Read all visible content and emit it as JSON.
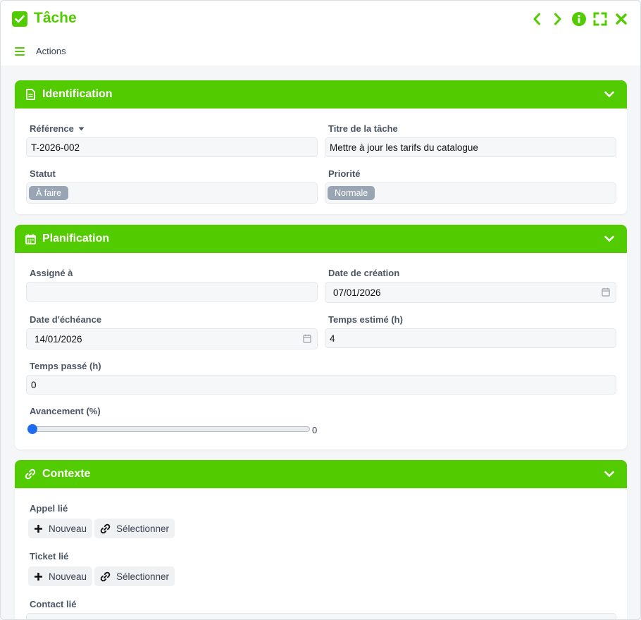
{
  "window": {
    "title": "Tâche",
    "actions_label": "Actions"
  },
  "colors": {
    "accent": "#52cc00",
    "badge_bg": "#9aa5b4",
    "slider_thumb": "#1d6cf0"
  },
  "sections": {
    "identification": {
      "title": "Identification",
      "reference_label": "Référence",
      "reference_value": "T-2026-002",
      "task_title_label": "Titre de la tâche",
      "task_title_value": "Mettre à jour les tarifs du catalogue",
      "status_label": "Statut",
      "status_value": "À faire",
      "priority_label": "Priorité",
      "priority_value": "Normale"
    },
    "planning": {
      "title": "Planification",
      "assigned_label": "Assigné à",
      "assigned_value": "",
      "created_label": "Date de création",
      "created_value": "07/01/2026",
      "due_label": "Date d'échéance",
      "due_value": "14/01/2026",
      "estimated_label": "Temps estimé (h)",
      "estimated_value": "4",
      "spent_label": "Temps passé (h)",
      "spent_value": "0",
      "progress_label": "Avancement (%)",
      "progress_value": "0"
    },
    "context": {
      "title": "Contexte",
      "call_label": "Appel lié",
      "ticket_label": "Ticket lié",
      "contact_label": "Contact lié",
      "new_label": "Nouveau",
      "select_label": "Sélectionner"
    }
  }
}
